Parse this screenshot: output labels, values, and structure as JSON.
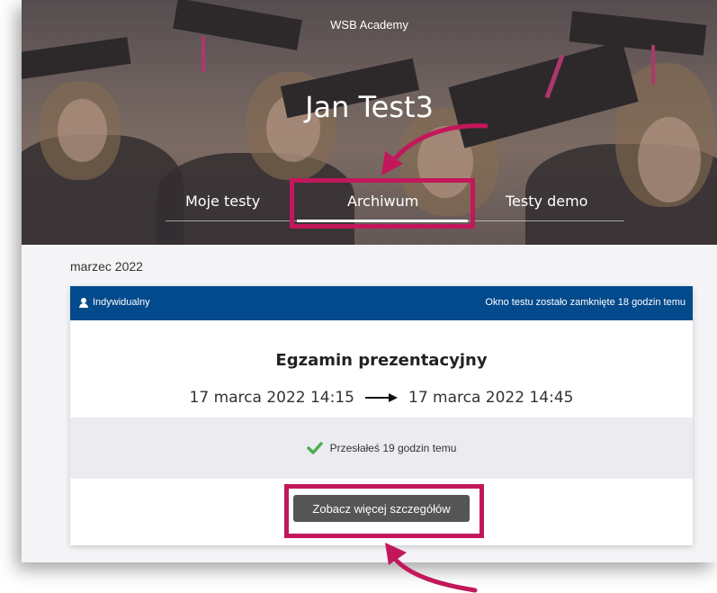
{
  "header": {
    "site_title": "WSB Academy",
    "user_name": "Jan Test3",
    "tabs": [
      {
        "label": "Moje testy"
      },
      {
        "label": "Archiwum"
      },
      {
        "label": "Testy demo"
      }
    ]
  },
  "main": {
    "month": "marzec 2022",
    "card": {
      "type_label": "Indywidualny",
      "window_status": "Okno testu zostało zamknięte 18 godzin temu",
      "exam_title": "Egzamin prezentacyjny",
      "start": "17 marca 2022 14:15",
      "end": "17 marca 2022 14:45",
      "submission_status": "Przesłałeś 19 godzin temu",
      "details_button": "Zobacz więcej szczegółów"
    }
  },
  "colors": {
    "header_blue": "#034a8c",
    "highlight_magenta": "#c2185b",
    "check_green": "#4caf50",
    "button_gray": "#555555"
  },
  "icons": [
    "person-icon",
    "arrow-right-icon",
    "check-icon",
    "curved-arrow-icon"
  ]
}
